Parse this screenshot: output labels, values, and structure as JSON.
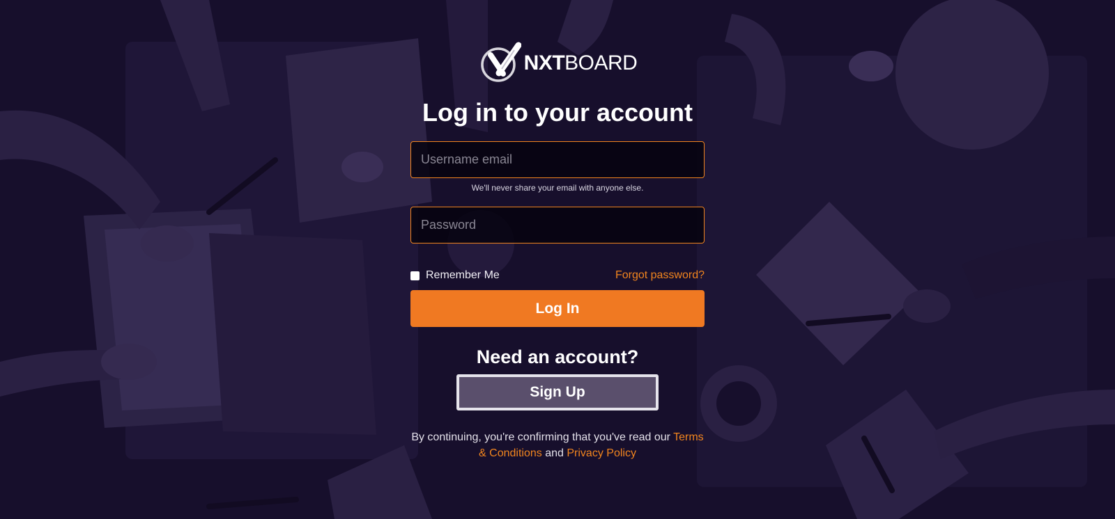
{
  "colors": {
    "accent": "#f2851e",
    "primary_button": "#f07922",
    "background": "#170f2c",
    "signup_button": "#5a4f6c"
  },
  "brand": {
    "logo_strong": "NXT",
    "logo_light": "BOARD",
    "logo_icon": "nxtboard-logo-icon"
  },
  "login": {
    "title": "Log in to your account",
    "username_placeholder": "Username email",
    "username_value": "",
    "email_help": "We'll never share your email with anyone else.",
    "password_placeholder": "Password",
    "password_value": "",
    "remember_label": "Remember Me",
    "remember_checked": false,
    "forgot_label": "Forgot password?",
    "login_button": "Log In"
  },
  "signup": {
    "heading": "Need an account?",
    "button": "Sign Up"
  },
  "legal": {
    "prefix": "By continuing, you're confirming that you've read our",
    "terms_link": "Terms & Conditions",
    "and": "and",
    "privacy_link": "Privacy Policy"
  }
}
